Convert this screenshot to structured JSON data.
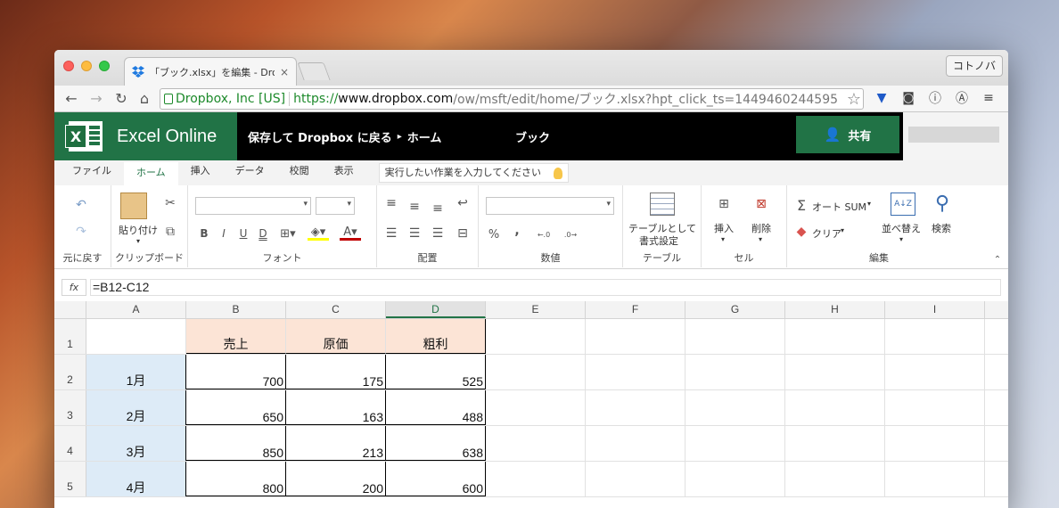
{
  "browser": {
    "tab_title": "「ブック.xlsx」を編集 - Drop",
    "tab_close": "×",
    "profile_button": "コトノバ",
    "ev_label": "Dropbox, Inc [US]",
    "url_scheme": "https://",
    "url_host": "www.dropbox.com",
    "url_path": "/ow/msft/edit/home/ブック.xlsx?hpt_click_ts=1449460244595"
  },
  "excel": {
    "app_name": "Excel Online",
    "back_link": "保存して Dropbox に戻る",
    "home_link": "ホーム",
    "doc_title": "ブック",
    "share_label": "共有"
  },
  "ribbon_tabs": [
    "ファイル",
    "ホーム",
    "挿入",
    "データ",
    "校閲",
    "表示"
  ],
  "tell_me": "実行したい作業を入力してください",
  "ribbon": {
    "undo_group": "元に戻す",
    "paste": "貼り付け",
    "clipboard_group": "クリップボード",
    "font_group": "フォント",
    "bold": "B",
    "italic": "I",
    "underline": "U",
    "double_underline": "D",
    "align_group": "配置",
    "percent": "%",
    "comma": ",",
    "number_group": "数値",
    "format_table": "テーブルとして",
    "format_table2": "書式設定",
    "table_group": "テーブル",
    "insert": "挿入",
    "delete": "削除",
    "cell_group": "セル",
    "autosum": "オート SUM",
    "clear": "クリア",
    "sort": "並べ替え",
    "find": "検索",
    "edit_group": "編集"
  },
  "formula_bar": {
    "fx": "fx",
    "value": "=B12-C12"
  },
  "sheet": {
    "columns": [
      "A",
      "B",
      "C",
      "D",
      "E",
      "F",
      "G",
      "H",
      "I"
    ],
    "rows": [
      {
        "n": "1",
        "a": "",
        "b": "売上",
        "c": "原価",
        "d": "粗利"
      },
      {
        "n": "2",
        "a": "1月",
        "b": "700",
        "c": "175",
        "d": "525"
      },
      {
        "n": "3",
        "a": "2月",
        "b": "650",
        "c": "163",
        "d": "488"
      },
      {
        "n": "4",
        "a": "3月",
        "b": "850",
        "c": "213",
        "d": "638"
      },
      {
        "n": "5",
        "a": "4月",
        "b": "800",
        "c": "200",
        "d": "600"
      }
    ]
  }
}
